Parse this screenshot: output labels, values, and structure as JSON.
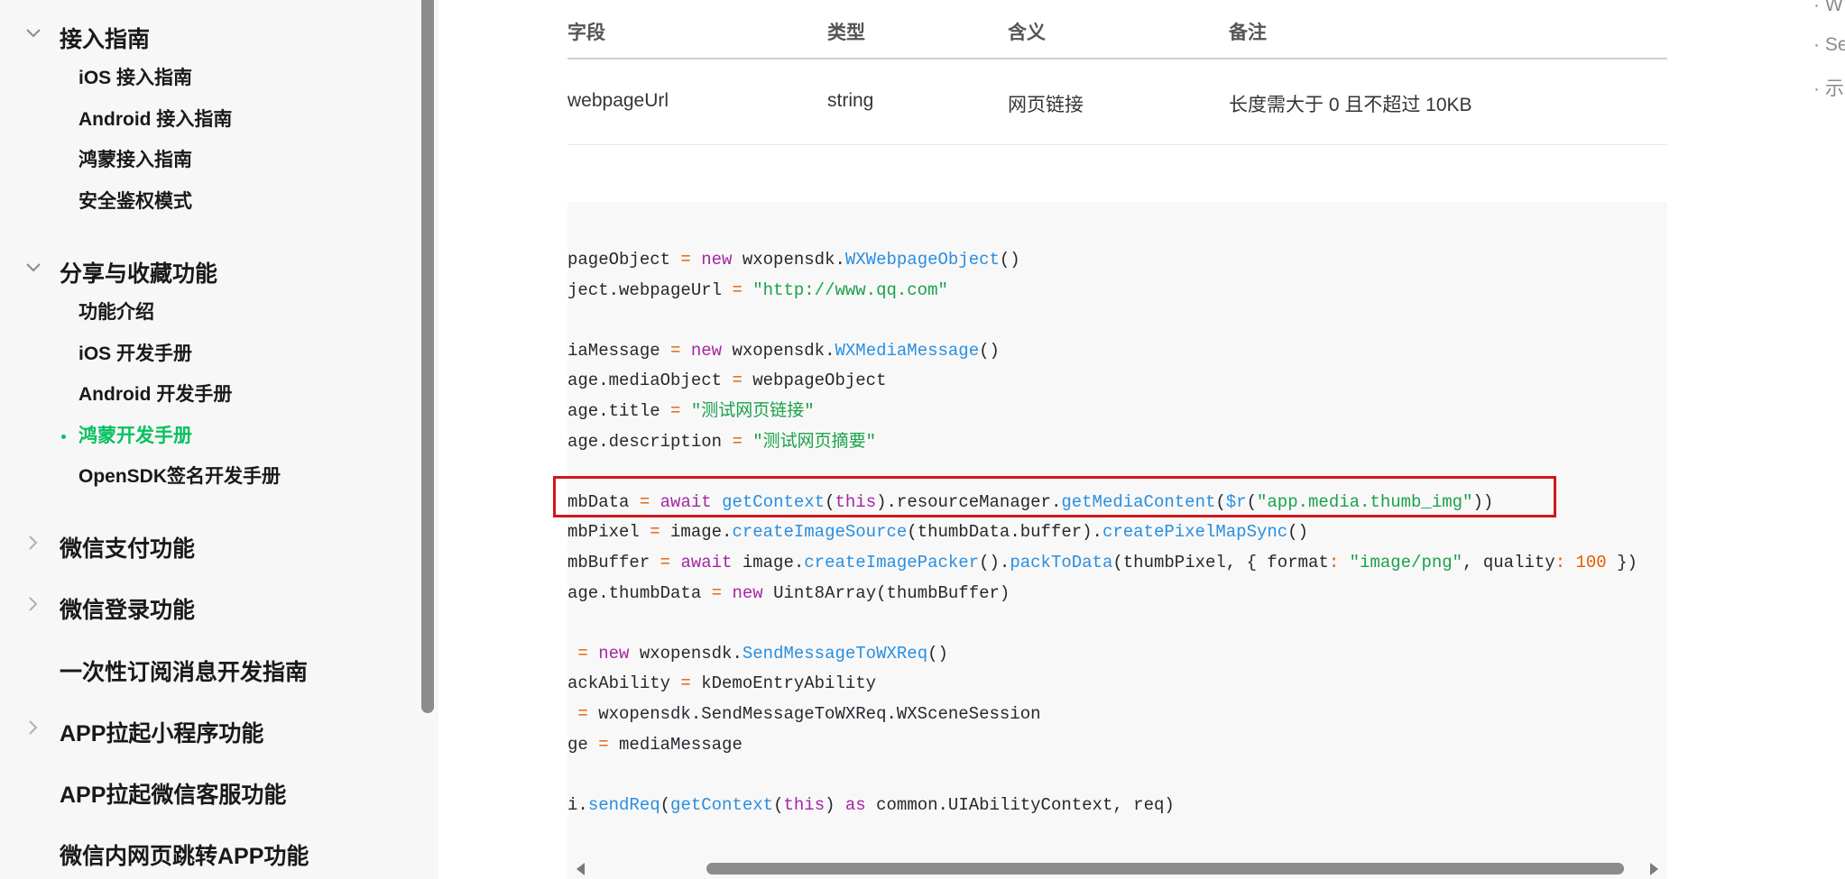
{
  "sidebar": {
    "sections": [
      {
        "label": "接入指南",
        "expanded": true,
        "items": [
          "iOS 接入指南",
          "Android 接入指南",
          "鸿蒙接入指南",
          "安全鉴权模式"
        ]
      },
      {
        "label": "分享与收藏功能",
        "expanded": true,
        "items": [
          "功能介绍",
          "iOS 开发手册",
          "Android 开发手册",
          "鸿蒙开发手册",
          "OpenSDK签名开发手册"
        ],
        "active_item": "鸿蒙开发手册"
      },
      {
        "label": "微信支付功能",
        "expanded": false
      },
      {
        "label": "微信登录功能",
        "expanded": false
      },
      {
        "label": "一次性订阅消息开发指南"
      },
      {
        "label": "APP拉起小程序功能",
        "expanded": false
      },
      {
        "label": "APP拉起微信客服功能"
      },
      {
        "label": "微信内网页跳转APP功能"
      }
    ]
  },
  "param_table": {
    "headers": [
      "字段",
      "类型",
      "含义",
      "备注"
    ],
    "rows": [
      [
        "webpageUrl",
        "string",
        "网页链接",
        "长度需大于 0 且不超过 10KB"
      ]
    ]
  },
  "code_lines": [
    "pageObject = new wxopensdk.WXWebpageObject()",
    "ject.webpageUrl = \"http://www.qq.com\"",
    "",
    "iaMessage = new wxopensdk.WXMediaMessage()",
    "age.mediaObject = webpageObject",
    "age.title = \"测试网页链接\"",
    "age.description = \"测试网页摘要\"",
    "",
    "mbData = await getContext(this).resourceManager.getMediaContent($r(\"app.media.thumb_img\"))",
    "mbPixel = image.createImageSource(thumbData.buffer).createPixelMapSync()",
    "mbBuffer = await image.createImagePacker().packToData(thumbPixel, { format: \"image/png\", quality: 100 })",
    "age.thumbData = new Uint8Array(thumbBuffer)",
    "",
    " = new wxopensdk.SendMessageToWXReq()",
    "ackAbility = kDemoEntryAbility",
    " = wxopensdk.SendMessageToWXReq.WXSceneSession",
    "ge = mediaMessage",
    "",
    "i.sendReq(getContext(this) as common.UIAbilityContext, req)"
  ],
  "toc": [
    "· W",
    "· Se",
    "· 示"
  ],
  "colors": {
    "accent_green": "#07c160",
    "keyword": "#a626a4",
    "function": "#2a8ee0",
    "string": "#1aa24a",
    "number": "#e45c00",
    "highlight_border": "#d0171c"
  }
}
